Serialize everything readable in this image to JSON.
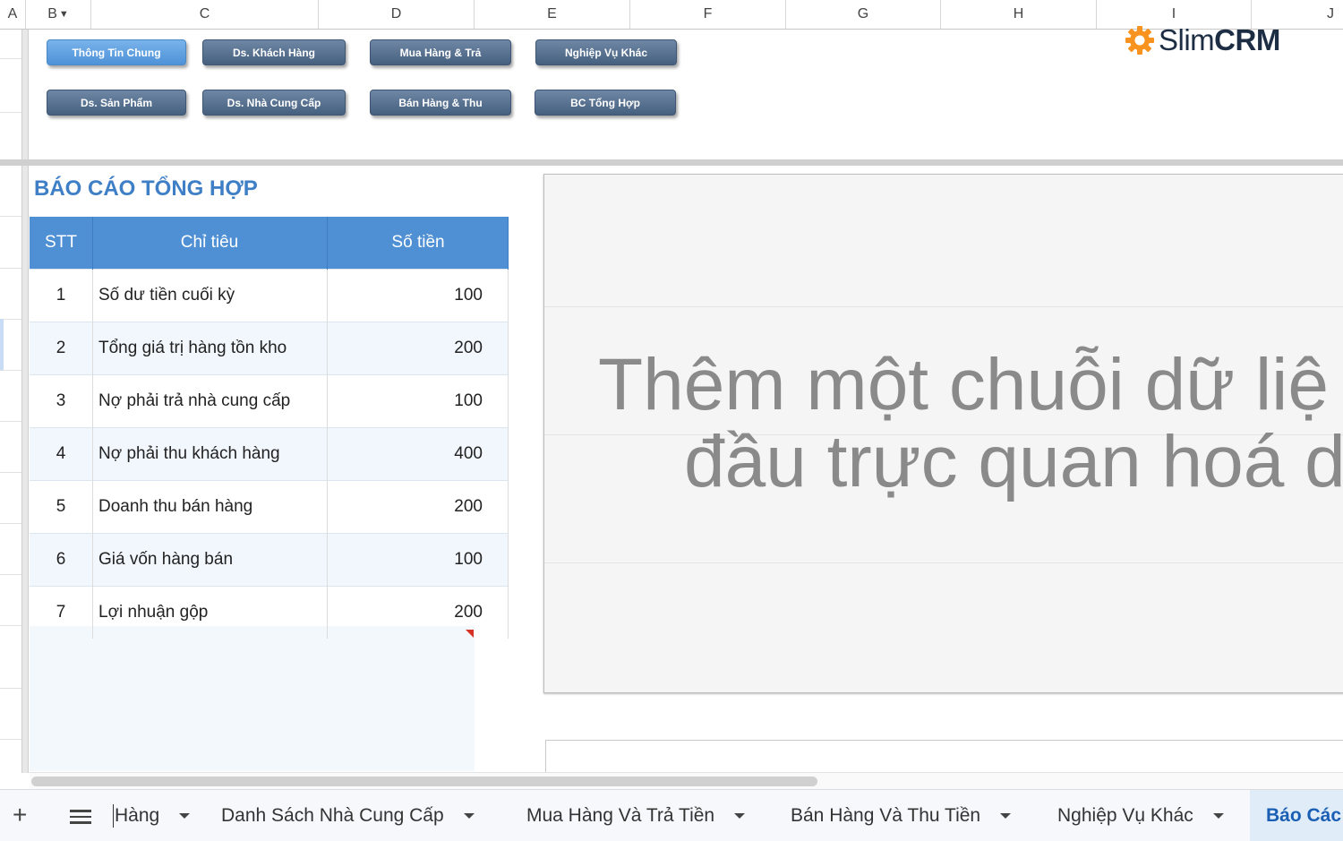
{
  "columns": [
    {
      "label": "A"
    },
    {
      "label": "B"
    },
    {
      "label": "C"
    },
    {
      "label": "D"
    },
    {
      "label": "E"
    },
    {
      "label": "F"
    },
    {
      "label": "G"
    },
    {
      "label": "H"
    },
    {
      "label": "I"
    },
    {
      "label": "J"
    }
  ],
  "nav_buttons": {
    "row1": [
      "Thông Tin Chung",
      "Ds. Khách Hàng",
      "Mua Hàng & Trả",
      "Nghiệp Vụ Khác"
    ],
    "row2": [
      "Ds. Sản Phẩm",
      "Ds. Nhà Cung Cấp",
      "Bán Hàng & Thu",
      "BC Tổng Hợp"
    ]
  },
  "logo": {
    "part1": "Slim",
    "part2": "CRM",
    "gear_color": "#f7931e"
  },
  "report": {
    "title": "BÁO CÁO TỔNG HỢP",
    "headers": {
      "stt": "STT",
      "chi_tieu": "Chỉ tiêu",
      "so_tien": "Số tiền"
    },
    "rows": [
      {
        "stt": "1",
        "chi_tieu": "Số dư tiền cuối kỳ",
        "so_tien": "100"
      },
      {
        "stt": "2",
        "chi_tieu": "Tổng giá trị hàng tồn kho",
        "so_tien": "200"
      },
      {
        "stt": "3",
        "chi_tieu": "Nợ phải trả nhà cung cấp",
        "so_tien": "100"
      },
      {
        "stt": "4",
        "chi_tieu": "Nợ phải thu khách hàng",
        "so_tien": "400"
      },
      {
        "stt": "5",
        "chi_tieu": "Doanh thu bán hàng",
        "so_tien": "200"
      },
      {
        "stt": "6",
        "chi_tieu": "Giá vốn hàng bán",
        "so_tien": "100"
      },
      {
        "stt": "7",
        "chi_tieu": "Lợi nhuận gộp",
        "so_tien": "200"
      }
    ],
    "header_color": "#4f8fd4"
  },
  "chart_placeholder": {
    "line1": "Thêm một chuỗi dữ liệ",
    "line2": "đầu trực quan hoá d"
  },
  "tabs": {
    "add": "+",
    "items": [
      "Hàng",
      "Danh Sách Nhà Cung Cấp",
      "Mua Hàng Và Trả Tiền",
      "Bán Hàng Và Thu Tiền",
      "Nghiệp Vụ Khác"
    ],
    "active": "Báo Các"
  }
}
